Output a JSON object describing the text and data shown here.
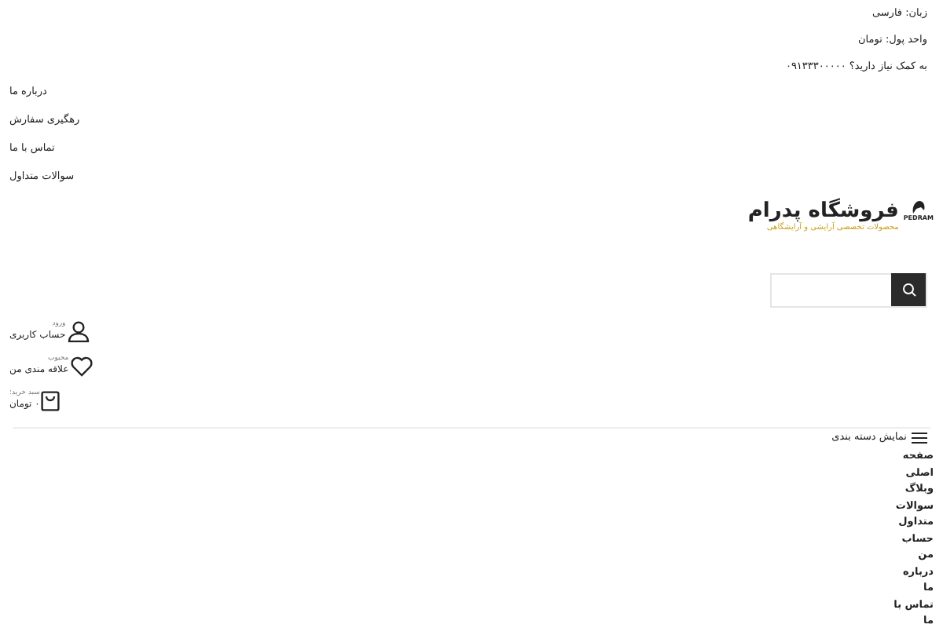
{
  "top_bar": {
    "language": "زبان: فارسی",
    "currency": "واحد پول: تومان",
    "help": "به کمک نیاز دارید؟ ۰۹۱۳۳۳۰۰۰۰۰"
  },
  "links": [
    "درباره ما",
    "رهگیری سفارش",
    "تماس با ما",
    "سوالات متداول"
  ],
  "logo": {
    "mark": "PEDRAM",
    "title": "فروشگاه پدرام",
    "tagline": "محصولات تخصصی آرایشی و آرایشگاهی"
  },
  "header_actions": [
    {
      "kind": "account",
      "label": "ورود",
      "value": "حساب کاربری"
    },
    {
      "kind": "wishlist",
      "label": "محبوب",
      "value": "علاقه مندی من"
    },
    {
      "kind": "cart",
      "label": "سبد خرید:",
      "value": "۰ تومان"
    }
  ],
  "category_toggle": "نمایش دسته بندی",
  "menu": [
    "صفحه اصلی",
    "وبلاگ",
    "سوالات متداول",
    "حساب من",
    "درباره ما",
    "تماس با ما"
  ]
}
